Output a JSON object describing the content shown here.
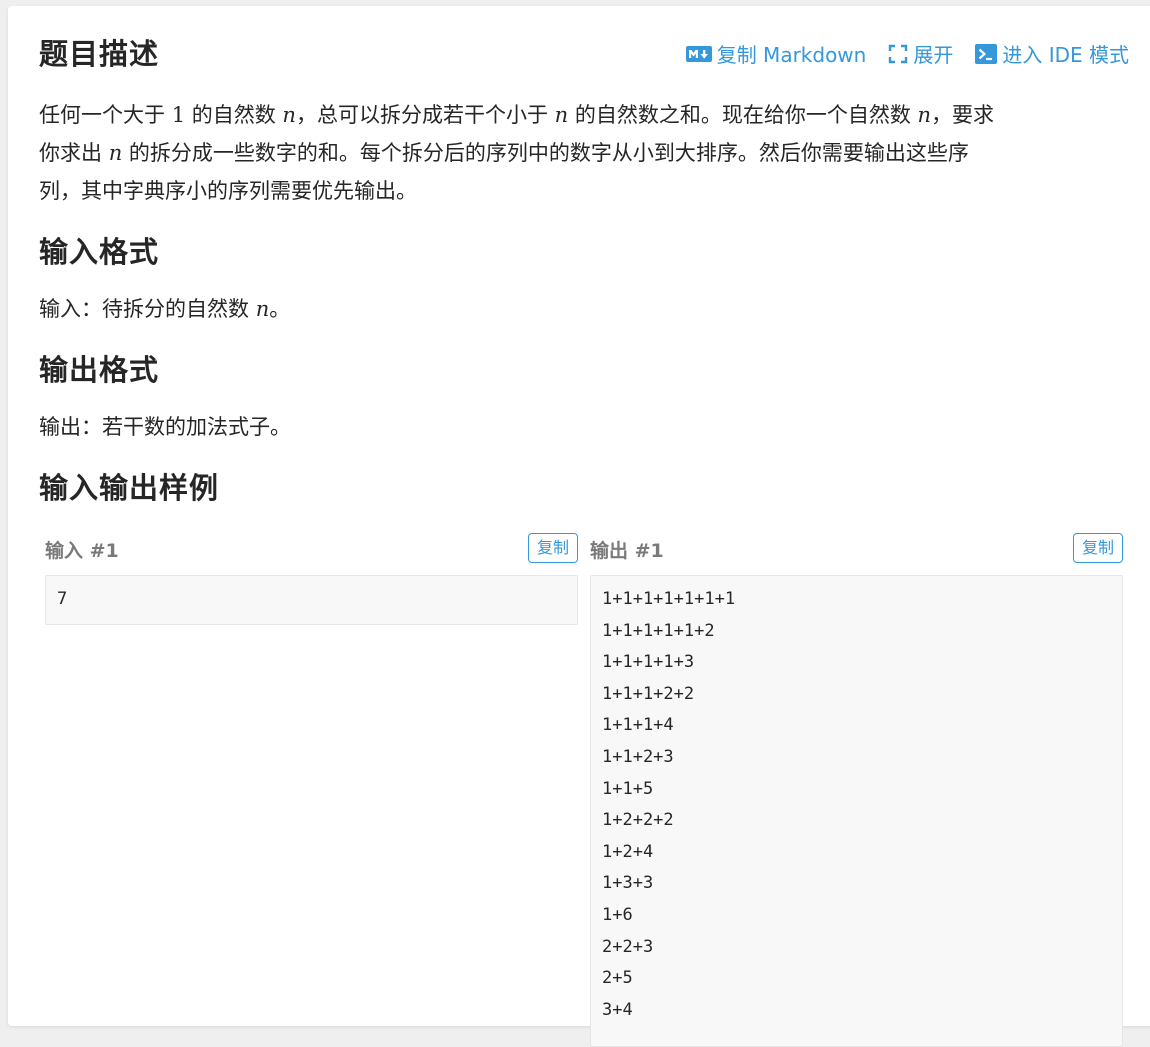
{
  "header": {
    "title": "题目描述",
    "actions": [
      {
        "label": "复制 Markdown",
        "icon": "markdown-icon"
      },
      {
        "label": "展开",
        "icon": "expand-icon"
      },
      {
        "label": "进入 IDE 模式",
        "icon": "terminal-icon"
      }
    ]
  },
  "description": {
    "line1": {
      "a": "任何一个大于 ",
      "one": "1",
      "b": " 的自然数 ",
      "n1": "n",
      "c": "，总可以拆分成若干个小于 ",
      "n2": "n",
      "d": " 的自然数之和。现在给你一个自然数 ",
      "n3": "n",
      "e": "，要求"
    },
    "line2": {
      "a": "你求出 ",
      "n": "n",
      "b": " 的拆分成一些数字的和。每个拆分后的序列中的数字从小到大排序。然后你需要输出这些序"
    },
    "line3": "列，其中字典序小的序列需要优先输出。"
  },
  "input_format": {
    "heading": "输入格式",
    "text_a": "输入：待拆分的自然数 ",
    "var": "n",
    "text_b": "。"
  },
  "output_format": {
    "heading": "输出格式",
    "text": "输出：若干数的加法式子。"
  },
  "samples": {
    "heading": "输入输出样例",
    "input": {
      "label": "输入 #1",
      "copy_label": "复制",
      "lines": [
        "7"
      ]
    },
    "output": {
      "label": "输出 #1",
      "copy_label": "复制",
      "lines": [
        "1+1+1+1+1+1+1",
        "1+1+1+1+1+2",
        "1+1+1+1+3",
        "1+1+1+2+2",
        "1+1+1+4",
        "1+1+2+3",
        "1+1+5",
        "1+2+2+2",
        "1+2+4",
        "1+3+3",
        "1+6",
        "2+2+3",
        "2+5",
        "3+4"
      ]
    }
  },
  "colors": {
    "accent": "#3498db",
    "text": "#262626",
    "label_gray": "#7a7a7a",
    "code_bg": "#f8f8f8"
  }
}
